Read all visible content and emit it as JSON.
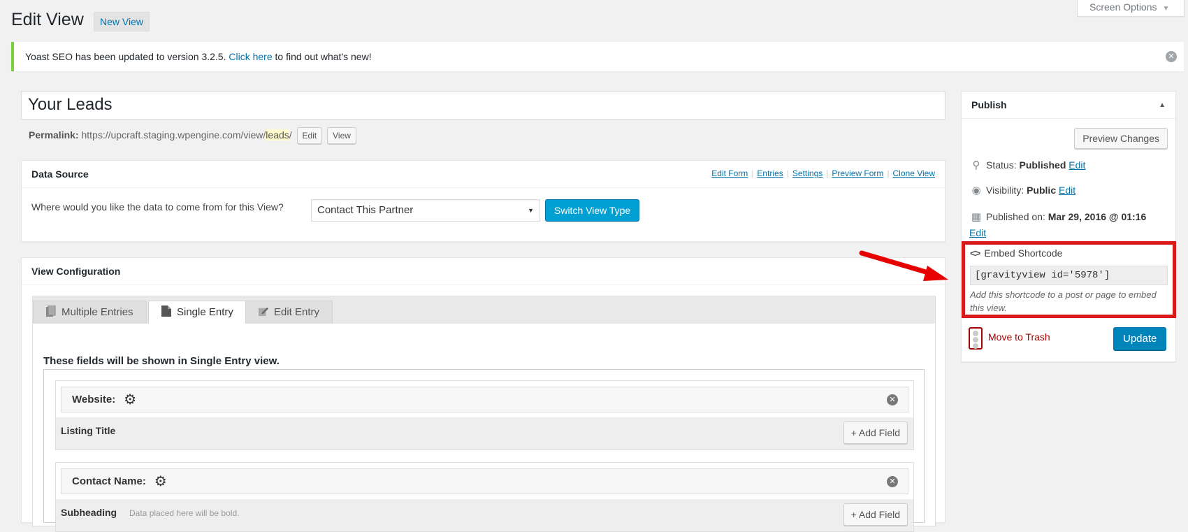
{
  "screen_options": {
    "label": "Screen Options"
  },
  "header": {
    "title": "Edit View",
    "new_button": "New View"
  },
  "notice": {
    "text_before": "Yoast SEO has been updated to version 3.2.5.",
    "link": "Click here",
    "text_after": "to find out what's new!"
  },
  "post": {
    "title": "Your Leads",
    "permalink_label": "Permalink:",
    "permalink_base": "https://upcraft.staging.wpengine.com/view/",
    "slug": "leads",
    "permalink_end": "/",
    "edit_button": "Edit",
    "view_button": "View"
  },
  "data_source": {
    "title": "Data Source",
    "links": [
      "Edit Form",
      "Entries",
      "Settings",
      "Preview Form",
      "Clone View"
    ],
    "question": "Where would you like the data to come from for this View?",
    "selected_form": "Contact This Partner",
    "switch_button": "Switch View Type"
  },
  "view_config": {
    "title": "View Configuration",
    "tabs": [
      {
        "label": "Multiple Entries",
        "icon": "multiple-entries-icon",
        "active": false
      },
      {
        "label": "Single Entry",
        "icon": "single-entry-icon",
        "active": true
      },
      {
        "label": "Edit Entry",
        "icon": "edit-entry-icon",
        "active": false
      }
    ],
    "shown_text": "These fields will be shown in Single Entry view.",
    "fields": [
      {
        "row_label": "Website:",
        "area_label": "Listing Title",
        "area_hint": "",
        "add_button": "+ Add Field"
      },
      {
        "row_label": "Contact Name:",
        "area_label": "Subheading",
        "area_hint": "Data placed here will be bold.",
        "add_button": "+ Add Field"
      }
    ]
  },
  "publish": {
    "title": "Publish",
    "preview_button": "Preview Changes",
    "status_label": "Status:",
    "status_value": "Published",
    "visibility_label": "Visibility:",
    "visibility_value": "Public",
    "published_label": "Published on:",
    "published_value": "Mar 29, 2016 @ 01:16",
    "edit_link": "Edit",
    "embed_title": "Embed Shortcode",
    "shortcode": "[gravityview id='5978']",
    "embed_hint": "Add this shortcode to a post or page to embed this view.",
    "trash_link": "Move to Trash",
    "update_button": "Update"
  },
  "colors": {
    "link": "#0073aa",
    "primary_button": "#0085ba",
    "switch_button": "#00a0d2",
    "highlight_box": "#d91a1a",
    "notice_border": "#7ad03a",
    "trash": "#aa0000"
  }
}
